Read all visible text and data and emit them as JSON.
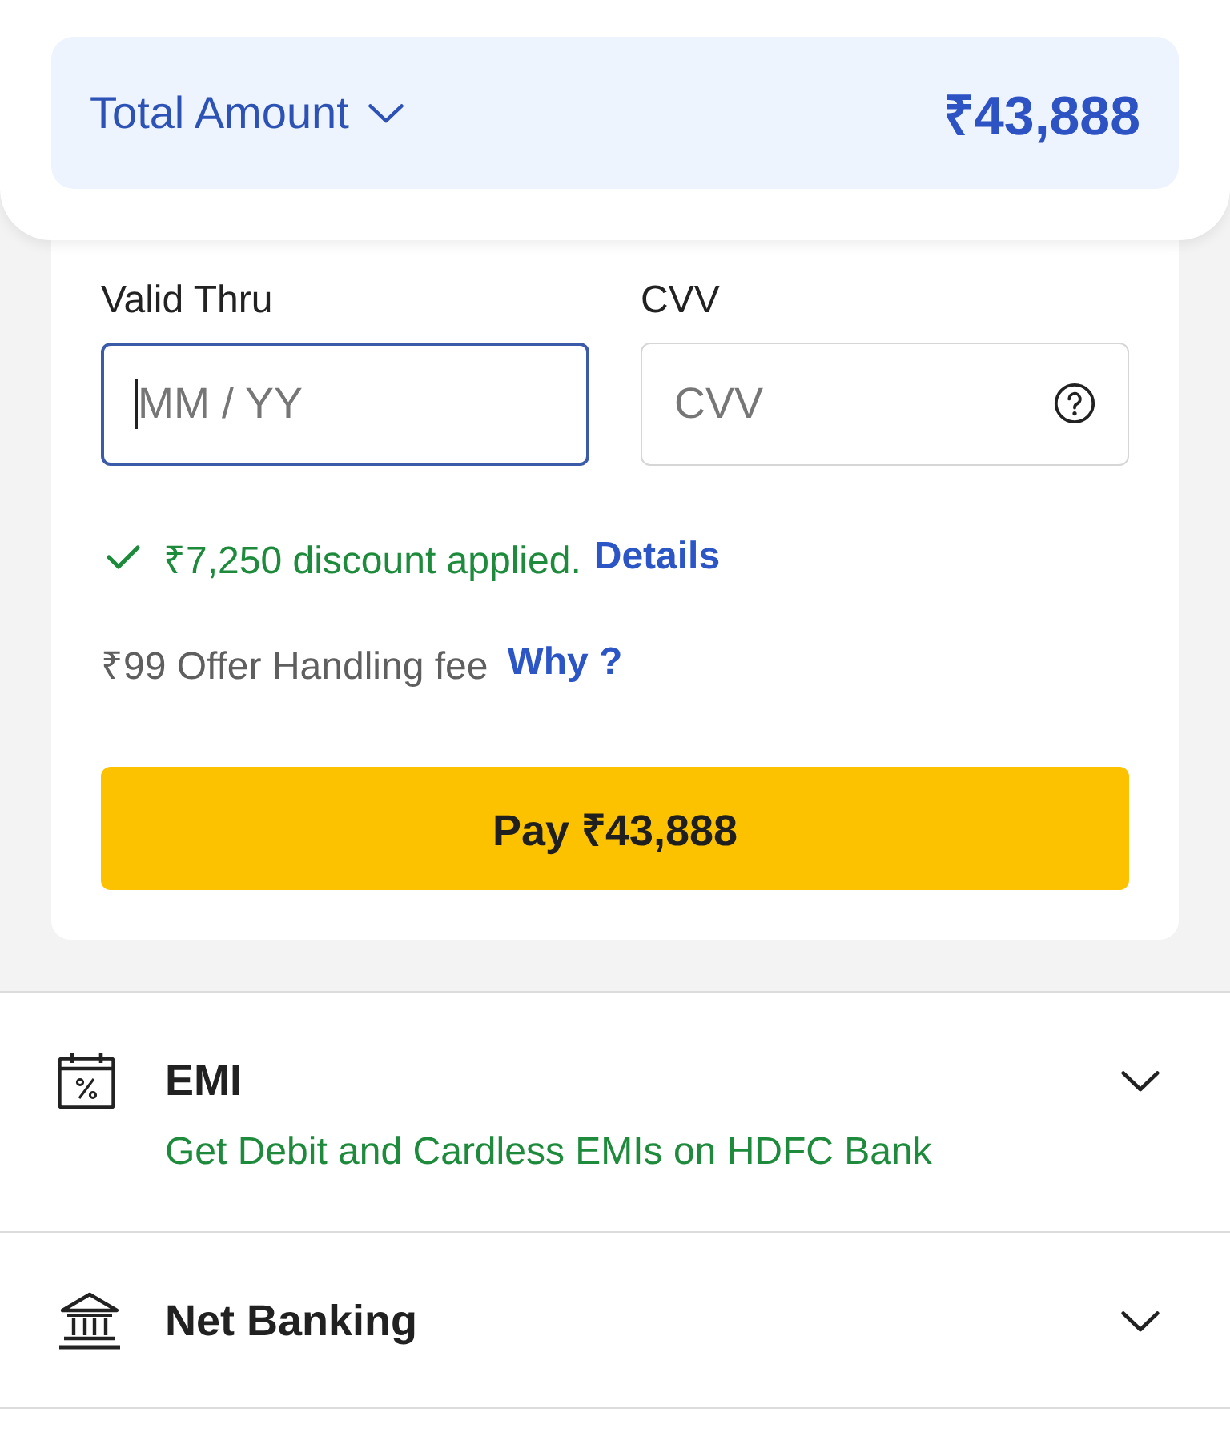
{
  "summary": {
    "label": "Total Amount",
    "expanded": false,
    "amount": "₹43,888"
  },
  "card_form": {
    "fields": [
      {
        "kind": "expiry",
        "label": "Valid Thru",
        "placeholder": "MM / YY",
        "focused": true
      },
      {
        "kind": "cvv",
        "label": "CVV",
        "placeholder": "CVV",
        "focused": false
      }
    ],
    "discount": {
      "text": "₹7,250 discount applied.",
      "link": "Details"
    },
    "fee": {
      "text": "₹99 Offer Handling fee",
      "link": "Why ?"
    },
    "pay_button": "Pay ₹43,888"
  },
  "payment_options": [
    {
      "kind": "emi",
      "title": "EMI",
      "subtitle": "Get Debit and Cardless EMIs on HDFC Bank",
      "expanded": false
    },
    {
      "kind": "netbanking",
      "title": "Net Banking",
      "expanded": false
    }
  ]
}
